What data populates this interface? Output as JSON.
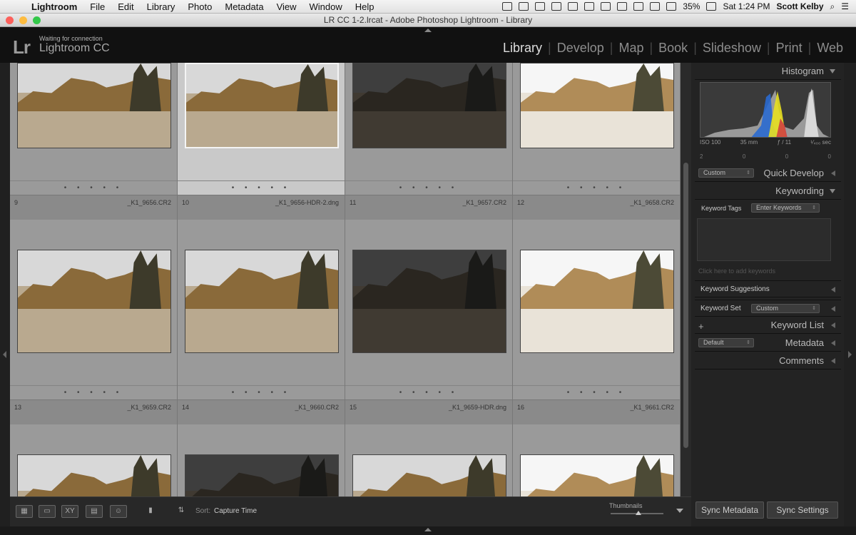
{
  "menubar": {
    "app": "Lightroom",
    "items": [
      "File",
      "Edit",
      "Library",
      "Photo",
      "Metadata",
      "View",
      "Window",
      "Help"
    ],
    "battery": "35%",
    "clock": "Sat 1:24 PM",
    "user": "Scott Kelby"
  },
  "window": {
    "title": "LR CC 1-2.lrcat - Adobe Photoshop Lightroom - Library"
  },
  "identity": {
    "logo": "Lr",
    "status": "Waiting for connection",
    "app_name": "Lightroom CC"
  },
  "modules": [
    "Library",
    "Develop",
    "Map",
    "Book",
    "Slideshow",
    "Print",
    "Web"
  ],
  "active_module": "Library",
  "grid": {
    "row1": [
      {
        "index": "",
        "filename": "",
        "tone": "normal"
      },
      {
        "index": "",
        "filename": "",
        "tone": "normal",
        "selected": true
      },
      {
        "index": "",
        "filename": "",
        "tone": "dark"
      },
      {
        "index": "",
        "filename": "",
        "tone": "bright"
      }
    ],
    "row2": [
      {
        "index": "9",
        "filename": "_K1_9656.CR2",
        "tone": "normal"
      },
      {
        "index": "10",
        "filename": "_K1_9656-HDR-2.dng",
        "tone": "normal"
      },
      {
        "index": "11",
        "filename": "_K1_9657.CR2",
        "tone": "dark"
      },
      {
        "index": "12",
        "filename": "_K1_9658.CR2",
        "tone": "bright"
      }
    ],
    "row3": [
      {
        "index": "13",
        "filename": "_K1_9659.CR2",
        "tone": "normal"
      },
      {
        "index": "14",
        "filename": "_K1_9660.CR2",
        "tone": "dark"
      },
      {
        "index": "15",
        "filename": "_K1_9659-HDR.dng",
        "tone": "normal"
      },
      {
        "index": "16",
        "filename": "_K1_9661.CR2",
        "tone": "bright"
      }
    ],
    "dots": "• • • • •"
  },
  "toolbar": {
    "sort_label": "Sort:",
    "sort_value": "Capture Time",
    "thumbnails_label": "Thumbnails",
    "thumbnail_size": 0.5
  },
  "panel": {
    "histogram_title": "Histogram",
    "iso": "ISO 100",
    "focal": "35 mm",
    "aperture": "ƒ / 11",
    "shutter": "¹⁄₄₀₀ sec",
    "hist_counts": [
      "2",
      "0",
      "0",
      "0"
    ],
    "quick_develop_preset": "Custom",
    "quick_develop_title": "Quick Develop",
    "keywording_title": "Keywording",
    "keyword_tags_label": "Keyword Tags",
    "keyword_tags_value": "Enter Keywords",
    "keyword_hint": "Click here to add keywords",
    "keyword_suggestions": "Keyword Suggestions",
    "keyword_set_label": "Keyword Set",
    "keyword_set_value": "Custom",
    "keyword_list_title": "Keyword List",
    "metadata_preset": "Default",
    "metadata_title": "Metadata",
    "comments_title": "Comments",
    "sync_metadata": "Sync Metadata",
    "sync_settings": "Sync Settings"
  },
  "colors": {
    "accent": "#dddddd",
    "panel": "#232323",
    "grid": "#9a9a9a"
  }
}
